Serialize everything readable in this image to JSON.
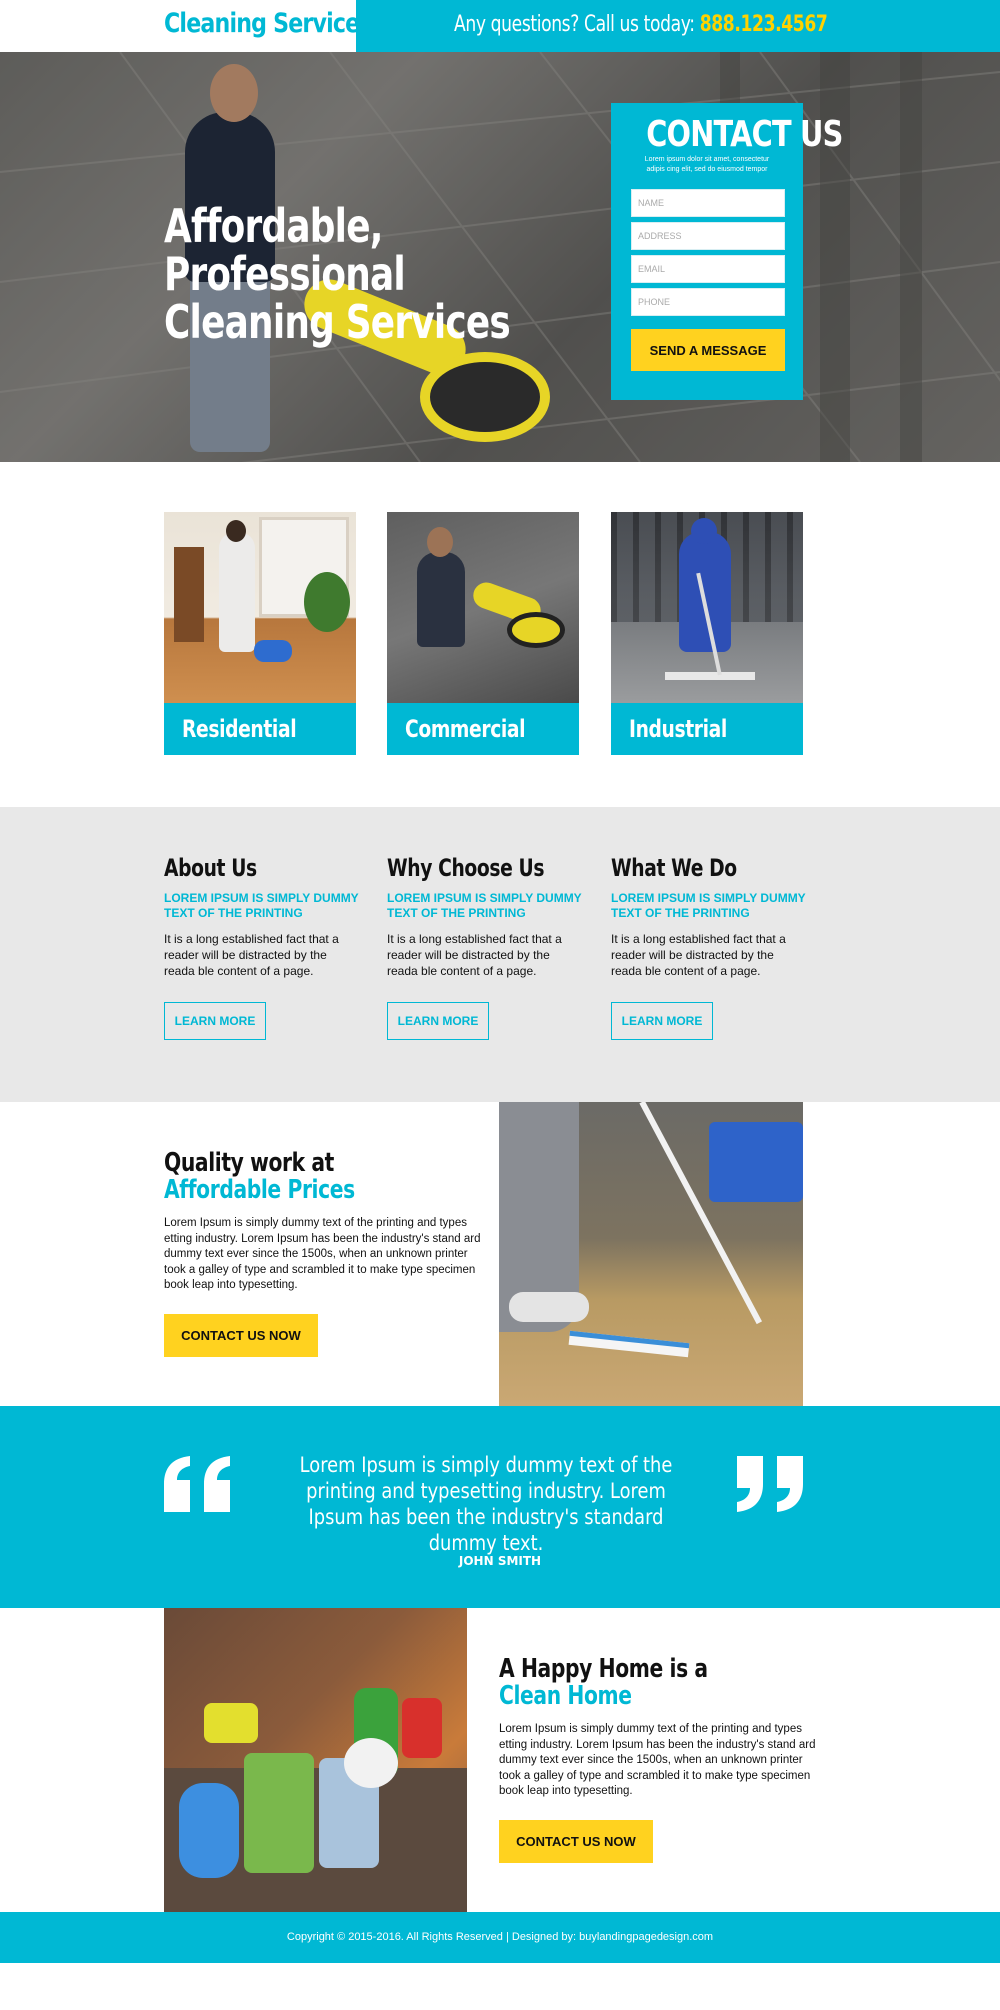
{
  "header": {
    "logo": "Cleaning Services",
    "question_text": "Any questions? Call us today: ",
    "phone": "888.123.4567"
  },
  "hero": {
    "title": "Affordable, Professional Cleaning Services"
  },
  "contact_form": {
    "heading": "CONTACT US",
    "blurb": "Lorem ipsum dolor sit amet, consectetur adipis cing elit, sed do eiusmod tempor",
    "name_placeholder": "NAME",
    "address_placeholder": "ADDRESS",
    "email_placeholder": "EMAIL",
    "phone_placeholder": "PHONE",
    "submit_label": "SEND A MESSAGE"
  },
  "services": [
    {
      "label": "Residential"
    },
    {
      "label": "Commercial"
    },
    {
      "label": "Industrial"
    }
  ],
  "info": [
    {
      "title": "About Us",
      "subtitle": "LOREM IPSUM IS SIMPLY DUMMY TEXT OF THE PRINTING",
      "body": "It is a long established fact that a reader will be distracted by the reada ble content of a page.",
      "button": "LEARN MORE"
    },
    {
      "title": "Why Choose Us",
      "subtitle": "LOREM IPSUM IS SIMPLY DUMMY TEXT OF THE PRINTING",
      "body": "It is a long established fact that a reader will be distracted by the reada ble content of a page.",
      "button": "LEARN MORE"
    },
    {
      "title": "What We Do",
      "subtitle": "LOREM IPSUM IS SIMPLY DUMMY TEXT OF THE PRINTING",
      "body": "It is a long established fact that a reader will be distracted by the reada ble content of a page.",
      "button": "LEARN MORE"
    }
  ],
  "quality": {
    "title_line1": "Quality work at",
    "title_line2": "Affordable Prices",
    "body": "Lorem Ipsum is simply dummy text of the printing and types etting industry. Lorem Ipsum has been the industry's stand ard dummy text ever since the 1500s, when an unknown printer took a galley of type and scrambled it to make  type specimen book leap into typesetting.",
    "button": "CONTACT US NOW"
  },
  "testimonial": {
    "quote": "Lorem Ipsum is simply dummy text of the printing and typesetting industry. Lorem Ipsum has been the industry's standard dummy text.",
    "author": "JOHN SMITH"
  },
  "happy_home": {
    "title_line1": "A Happy Home is a",
    "title_line2": "Clean Home",
    "body": "Lorem Ipsum is simply dummy text of the printing and types etting industry. Lorem Ipsum has been the industry's stand ard dummy text ever since the 1500s, when an unknown printer took a galley of type and scrambled it to make  type specimen book leap into typesetting.",
    "button": "CONTACT US NOW"
  },
  "footer": {
    "text": "Copyright © 2015-2016. All Rights Reserved  |  Designed by: buylandingpagedesign.com"
  },
  "colors": {
    "accent": "#00b8d4",
    "cta_yellow": "#ffd21f",
    "phone_yellow": "#ffd200",
    "band_gray": "#e8e8e8"
  },
  "icons": [
    "open-quote-icon",
    "close-quote-icon"
  ]
}
